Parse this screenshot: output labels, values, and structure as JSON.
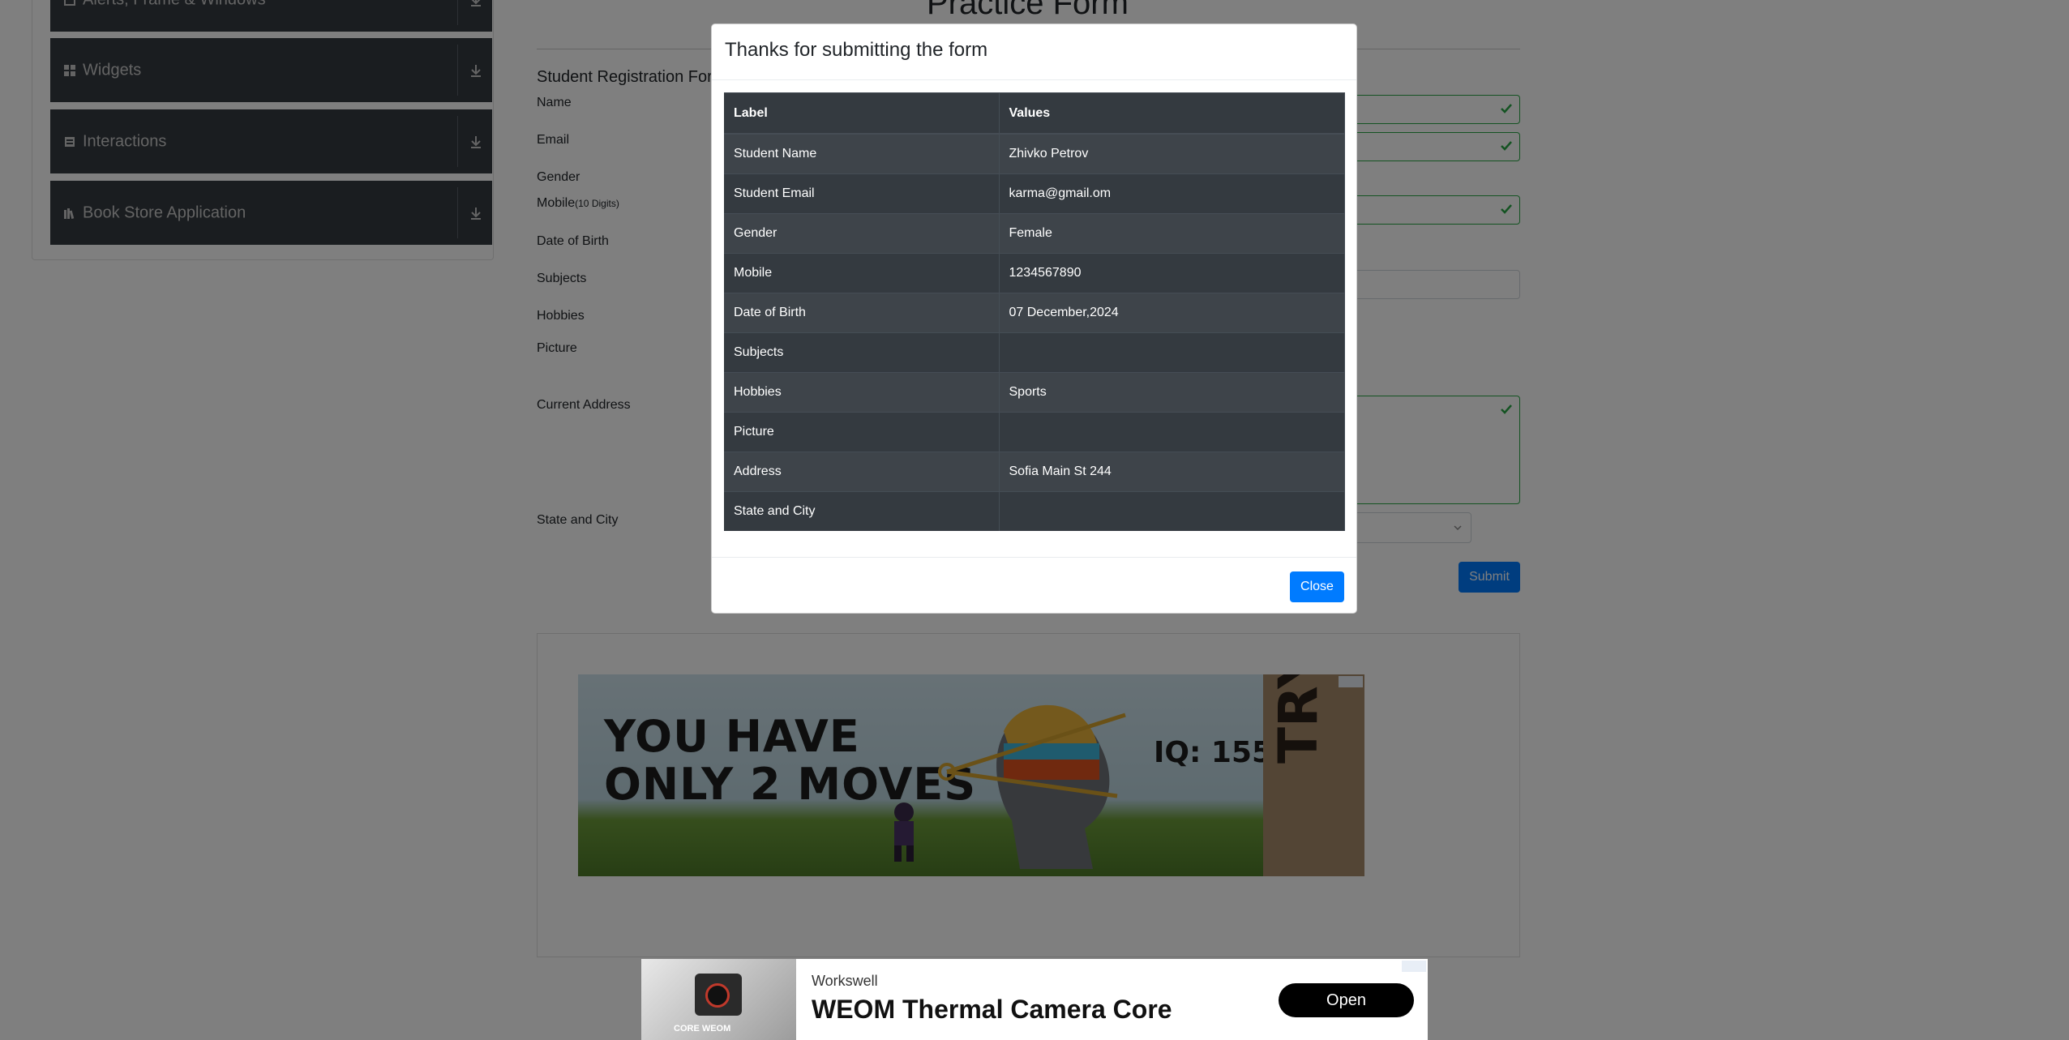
{
  "sidebar": {
    "groups": [
      {
        "label": "Alerts, Frame & Windows",
        "icon": "window-icon"
      },
      {
        "label": "Widgets",
        "icon": "widgets-icon"
      },
      {
        "label": "Interactions",
        "icon": "interactions-icon"
      },
      {
        "label": "Book Store Application",
        "icon": "bookstore-icon"
      }
    ]
  },
  "page": {
    "title": "Practice Form",
    "subtitle": "Student Registration Form",
    "labels": {
      "name": "Name",
      "email": "Email",
      "gender": "Gender",
      "mobile": "Mobile",
      "mobile_hint": "(10 Digits)",
      "dob": "Date of Birth",
      "subjects": "Subjects",
      "hobbies": "Hobbies",
      "picture": "Picture",
      "current_address": "Current Address",
      "state_city": "State and City"
    },
    "submit_label": "Submit"
  },
  "modal": {
    "title": "Thanks for submitting the form",
    "table": {
      "headers": [
        "Label",
        "Values"
      ],
      "rows": [
        [
          "Student Name",
          "Zhivko Petrov"
        ],
        [
          "Student Email",
          "karma@gmail.om"
        ],
        [
          "Gender",
          "Female"
        ],
        [
          "Mobile",
          "1234567890"
        ],
        [
          "Date of Birth",
          "07 December,2024"
        ],
        [
          "Subjects",
          ""
        ],
        [
          "Hobbies",
          "Sports"
        ],
        [
          "Picture",
          ""
        ],
        [
          "Address",
          "Sofia Main St 244"
        ],
        [
          "State and City",
          ""
        ]
      ]
    },
    "close_label": "Close"
  },
  "game_ad": {
    "line1": "YOU HAVE",
    "line2": "ONLY 2 MOVES",
    "iq": "IQ: 155",
    "cta": "TRY"
  },
  "bottom_ad": {
    "brand": "Workswell",
    "headline": "WEOM Thermal Camera Core",
    "thumb_caption": "CORE WEOM",
    "cta": "Open"
  },
  "colors": {
    "accent": "#007bff",
    "table_dark": "#343a40",
    "table_stripe": "#3e444a",
    "valid": "#28a745"
  }
}
